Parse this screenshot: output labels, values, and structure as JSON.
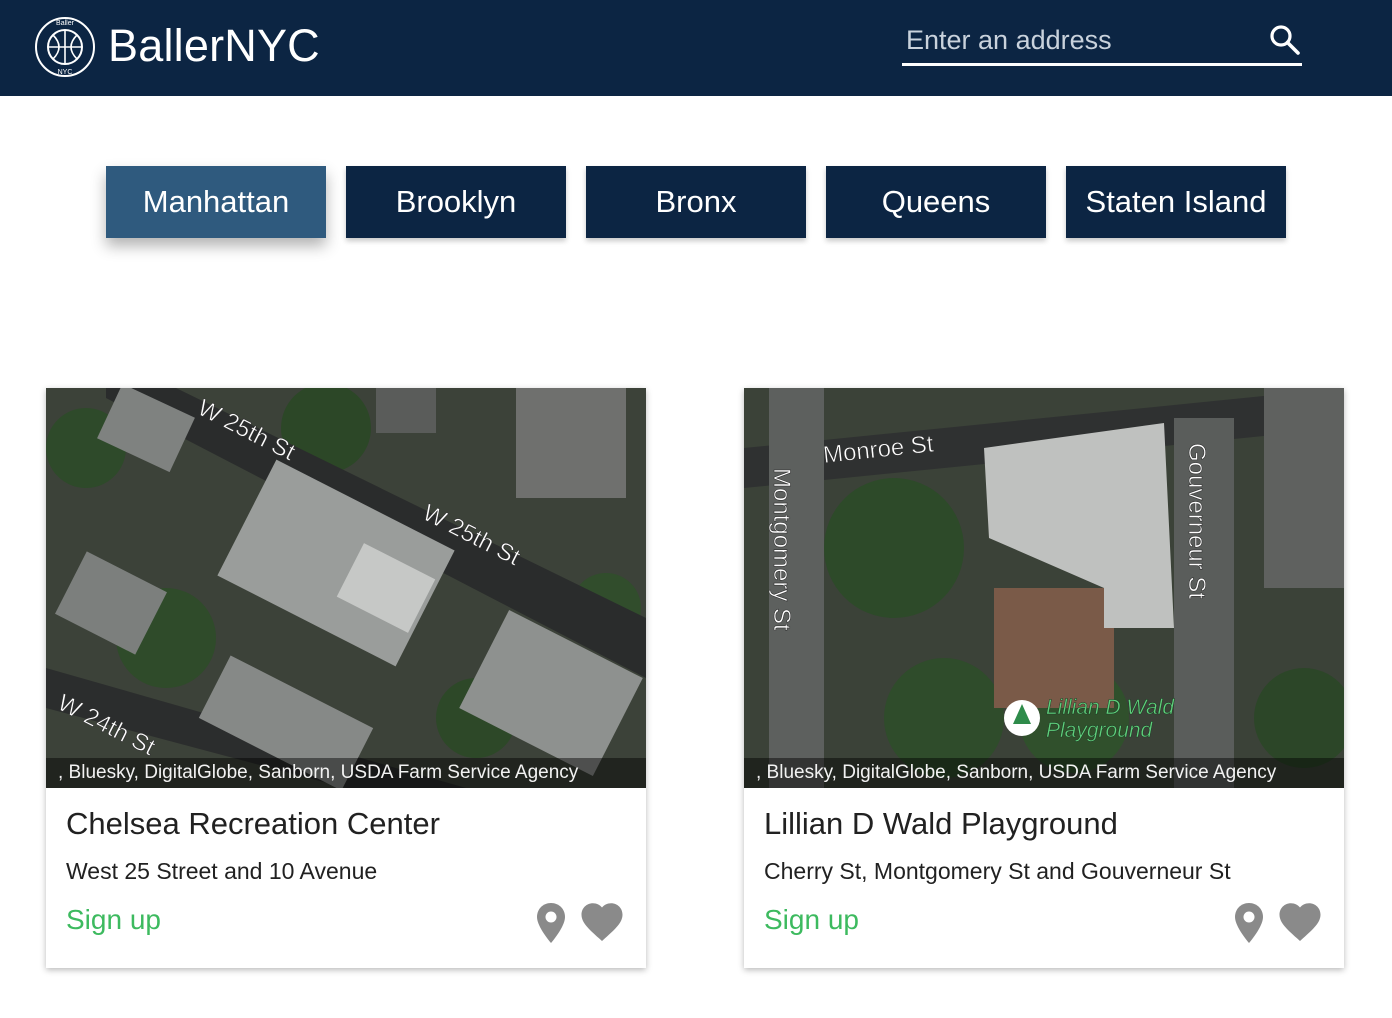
{
  "header": {
    "brand": "BallerNYC",
    "logo_top_text": "Baller",
    "logo_bottom_text": "NYC",
    "search_placeholder": "Enter an address",
    "search_icon": "search-icon"
  },
  "boroughs": [
    {
      "label": "Manhattan",
      "active": true
    },
    {
      "label": "Brooklyn",
      "active": false
    },
    {
      "label": "Bronx",
      "active": false
    },
    {
      "label": "Queens",
      "active": false
    },
    {
      "label": "Staten Island",
      "active": false
    }
  ],
  "cards": [
    {
      "title": "Chelsea Recreation Center",
      "address": "West 25 Street and 10 Avenue",
      "signup_label": "Sign up",
      "map_labels": [
        "W 25th St",
        "W 25th St",
        "W 24th St"
      ],
      "attribution": ", Bluesky, DigitalGlobe, Sanborn, USDA Farm Service Agency"
    },
    {
      "title": "Lillian D Wald Playground",
      "address": "Cherry St, Montgomery St and Gouverneur St",
      "signup_label": "Sign up",
      "map_labels": [
        "Monroe St",
        "Montgomery St",
        "Gouverneur St",
        "Lillian D Wald",
        "Playground"
      ],
      "attribution": ", Bluesky, DigitalGlobe, Sanborn, USDA Farm Service Agency"
    }
  ],
  "colors": {
    "navbar": "#0c2543",
    "button": "#0c2543",
    "button_active": "#2f5a7e",
    "signup": "#3dba5f",
    "icon_gray": "#8a8a8a"
  },
  "icons": {
    "pin": "map-pin-icon",
    "heart": "heart-icon"
  }
}
